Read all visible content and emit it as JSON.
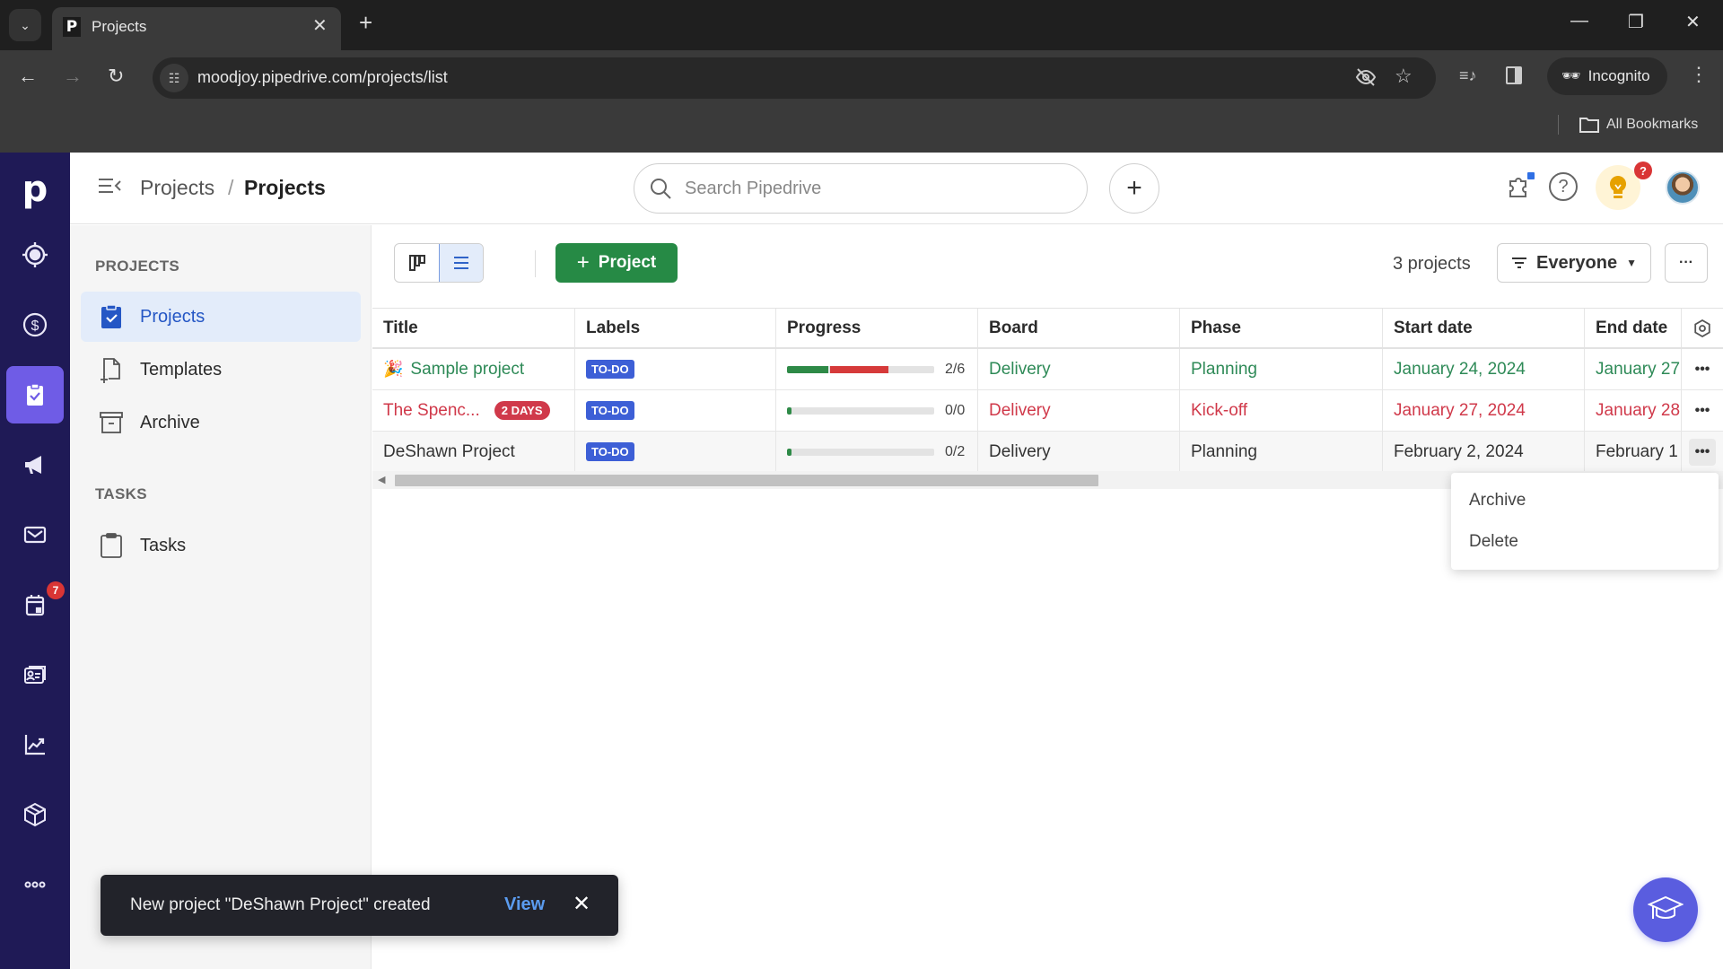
{
  "browser": {
    "tab_title": "Projects",
    "tab_favicon": "P",
    "url": "moodjoy.pipedrive.com/projects/list",
    "incognito_label": "Incognito",
    "bookmarks_label": "All Bookmarks"
  },
  "rail": {
    "logo": "p",
    "items": [
      {
        "name": "leads-icon"
      },
      {
        "name": "deals-icon"
      },
      {
        "name": "projects-icon",
        "active": true
      },
      {
        "name": "campaigns-icon"
      },
      {
        "name": "mail-icon"
      },
      {
        "name": "activities-icon",
        "badge": "7"
      },
      {
        "name": "contacts-icon"
      },
      {
        "name": "insights-icon"
      },
      {
        "name": "products-icon"
      },
      {
        "name": "more-icon"
      }
    ],
    "activities_badge": "7"
  },
  "header": {
    "breadcrumb_parent": "Projects",
    "breadcrumb_separator": "/",
    "breadcrumb_current": "Projects",
    "search_placeholder": "Search Pipedrive",
    "quick_add": "+",
    "tips_badge": "?"
  },
  "subnav": {
    "section_projects": "PROJECTS",
    "items": [
      {
        "label": "Projects",
        "active": true
      },
      {
        "label": "Templates"
      },
      {
        "label": "Archive"
      }
    ],
    "section_tasks": "TASKS",
    "tasks_item": "Tasks"
  },
  "toolbar": {
    "add_project_label": "Project",
    "project_count": "3 projects",
    "filter_label": "Everyone",
    "more_label": "···"
  },
  "table": {
    "columns": [
      "Title",
      "Labels",
      "Progress",
      "Board",
      "Phase",
      "Start date",
      "End date"
    ],
    "rows": [
      {
        "title": "Sample project",
        "has_icon": true,
        "label": "TO-DO",
        "progress_text": "2/6",
        "progress_done_fraction": 0.28,
        "progress_overdue_fraction": 0.4,
        "board": "Delivery",
        "phase": "Planning",
        "start_date": "January 24, 2024",
        "end_date": "January 27",
        "status": "green"
      },
      {
        "title": "The Spenc...",
        "badge": "2 DAYS",
        "label": "TO-DO",
        "progress_text": "0/0",
        "progress_done_fraction": 0.0,
        "progress_overdue_fraction": 0.0,
        "board": "Delivery",
        "phase": "Kick-off",
        "start_date": "January 27, 2024",
        "end_date": "January 28",
        "status": "red"
      },
      {
        "title": "DeShawn Project",
        "label": "TO-DO",
        "progress_text": "0/2",
        "progress_done_fraction": 0.0,
        "progress_overdue_fraction": 0.0,
        "board": "Delivery",
        "phase": "Planning",
        "start_date": "February 2, 2024",
        "end_date": "February 1",
        "status": "default"
      }
    ],
    "horizontal_scroll_visible_fraction": 0.53
  },
  "context_menu": {
    "items": [
      "Archive",
      "Delete"
    ]
  },
  "toast": {
    "message": "New project \"DeShawn Project\" created",
    "action": "View"
  },
  "colors": {
    "rail_bg": "#1f1a56",
    "rail_active": "#6f5ce6",
    "primary_green": "#268a45",
    "status_green": "#2e8a57",
    "status_red": "#d0394a",
    "label_blue": "#3d5fd6",
    "link_blue": "#5b9cf0"
  }
}
